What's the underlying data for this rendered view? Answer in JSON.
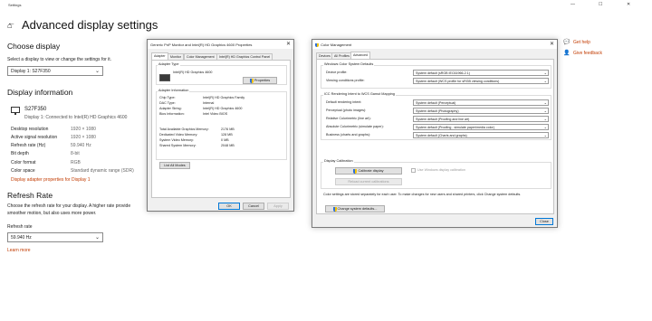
{
  "settings": {
    "window_title": "Settings",
    "page_title": "Advanced display settings",
    "choose_display": {
      "heading": "Choose display",
      "subtext": "Select a display to view or change the settings for it.",
      "selected": "Display 1: S27F350"
    },
    "display_info": {
      "heading": "Display information",
      "monitor_name": "S27F350",
      "monitor_sub": "Display 1: Connected to Intel(R) HD Graphics 4600",
      "rows": [
        {
          "key": "Desktop resolution",
          "value": "1920 × 1080"
        },
        {
          "key": "Active signal resolution",
          "value": "1920 × 1080"
        },
        {
          "key": "Refresh rate (Hz)",
          "value": "59.940 Hz"
        },
        {
          "key": "Bit depth",
          "value": "8-bit"
        },
        {
          "key": "Color format",
          "value": "RGB"
        },
        {
          "key": "Color space",
          "value": "Standard dynamic range (SDR)"
        }
      ],
      "adapter_link": "Display adapter properties for Display 1"
    },
    "refresh": {
      "heading": "Refresh Rate",
      "text1": "Choose the refresh rate for your display. A higher rate provide",
      "text2": "smoother motion, but also uses more power.",
      "label": "Refresh rate",
      "selected": "59.940 Hz",
      "learn_more": "Learn more"
    },
    "help": {
      "get_help": "Get help",
      "give_feedback": "Give feedback"
    }
  },
  "adapter_dialog": {
    "title": "Generic PnP Monitor and Intel(R) HD Graphics 4600 Properties",
    "tabs": [
      "Adapter",
      "Monitor",
      "Color Management",
      "Intel(R) HD Graphics Control Panel"
    ],
    "adapter_type_label": "Adapter Type",
    "adapter_name": "Intel(R) HD Graphics 4600",
    "properties_btn": "Properties",
    "info_label": "Adapter Information",
    "info_rows": [
      {
        "key": "Chip Type:",
        "value": "Intel(R) HD Graphics Family"
      },
      {
        "key": "DAC Type:",
        "value": "Internal"
      },
      {
        "key": "Adapter String:",
        "value": "Intel(R) HD Graphics 4600"
      },
      {
        "key": "Bios Information:",
        "value": "Intel Video BIOS"
      }
    ],
    "mem_rows": [
      {
        "key": "Total Available Graphics Memory:",
        "value": "2176 MB"
      },
      {
        "key": "Dedicated Video Memory:",
        "value": "128 MB"
      },
      {
        "key": "System Video Memory:",
        "value": "0 MB"
      },
      {
        "key": "Shared System Memory:",
        "value": "2048 MB"
      }
    ],
    "list_modes_btn": "List All Modes",
    "ok": "OK",
    "cancel": "Cancel",
    "apply": "Apply"
  },
  "color_dialog": {
    "title": "Color Management",
    "tabs": [
      "Devices",
      "All Profiles",
      "Advanced"
    ],
    "defaults_label": "Windows Color System Defaults",
    "device_profile_label": "Device profile:",
    "device_profile_value": "System default (sRGB IEC61966-2.1)",
    "viewing_label": "Viewing conditions profile:",
    "viewing_value": "System default (WCS profile for sRGB viewing conditions)",
    "icc_label": "ICC Rendering Intent to WCS Gamut Mapping",
    "icc_rows": [
      {
        "key": "Default rendering intent:",
        "value": "System default (Perceptual)"
      },
      {
        "key": "Perceptual (photo images):",
        "value": "System default (Photography)"
      },
      {
        "key": "Relative Colorimetric (line art):",
        "value": "System default (Proofing and line art)"
      },
      {
        "key": "Absolute Colorimetric (simulate paper):",
        "value": "System default (Proofing - simulate paper/media color)"
      },
      {
        "key": "Business (charts and graphs):",
        "value": "System default (Charts and graphs)"
      }
    ],
    "calibration_label": "Display Calibration",
    "calibrate_btn": "Calibrate display",
    "use_windows_cal": "Use Windows display calibration",
    "reload_btn": "Reload current calibrations",
    "note": "Color settings are stored separately for each user. To make changes for new users and shared printers, click Change system defaults.",
    "change_defaults_btn": "Change system defaults...",
    "close_btn": "Close"
  },
  "colors": {
    "link": "#c23b00",
    "accent": "#0078d7"
  }
}
